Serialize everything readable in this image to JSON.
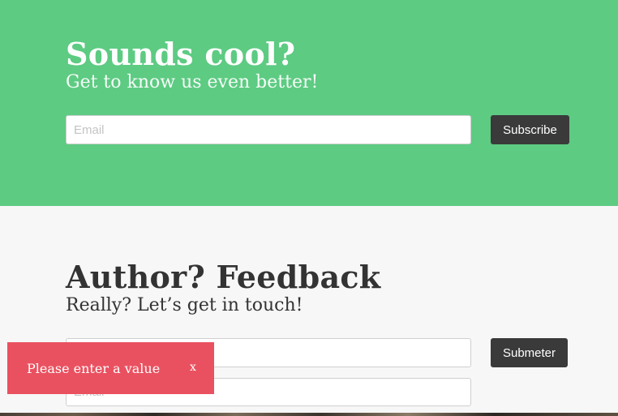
{
  "newsletter": {
    "title": "Sounds cool?",
    "subtitle": "Get to know us even better!",
    "email_placeholder": "Email",
    "subscribe_label": "Subscribe"
  },
  "feedback": {
    "title": "Author? Feedback",
    "subtitle": "Really? Let’s get in touch!",
    "email_placeholder": "Email",
    "second_placeholder": "Email",
    "submit_label": "Submeter"
  },
  "toast": {
    "message": "Please enter a value",
    "close_label": "x"
  },
  "colors": {
    "green_section": "#5dcb82",
    "button_bg": "#3a3a3a",
    "toast_bg": "#ea5160"
  }
}
